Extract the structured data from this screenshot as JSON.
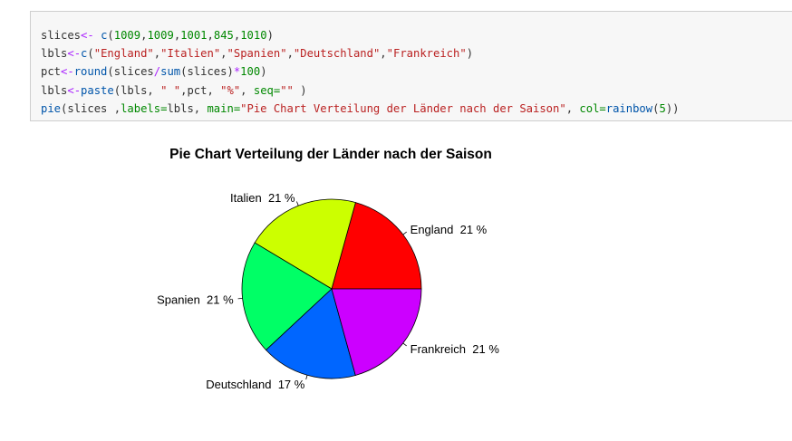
{
  "code_cell": {
    "lines": [
      [
        {
          "t": "slices",
          "c": "v"
        },
        {
          "t": "<-",
          "c": "op"
        },
        {
          "t": " ",
          "c": "p"
        },
        {
          "t": "c",
          "c": "fn"
        },
        {
          "t": "(",
          "c": "p"
        },
        {
          "t": "1009",
          "c": "num"
        },
        {
          "t": ",",
          "c": "p"
        },
        {
          "t": "1009",
          "c": "num"
        },
        {
          "t": ",",
          "c": "p"
        },
        {
          "t": "1001",
          "c": "num"
        },
        {
          "t": ",",
          "c": "p"
        },
        {
          "t": "845",
          "c": "num"
        },
        {
          "t": ",",
          "c": "p"
        },
        {
          "t": "1010",
          "c": "num"
        },
        {
          "t": ")",
          "c": "p"
        }
      ],
      [
        {
          "t": "lbls",
          "c": "v"
        },
        {
          "t": "<-",
          "c": "op"
        },
        {
          "t": "c",
          "c": "fn"
        },
        {
          "t": "(",
          "c": "p"
        },
        {
          "t": "\"England\"",
          "c": "str"
        },
        {
          "t": ",",
          "c": "p"
        },
        {
          "t": "\"Italien\"",
          "c": "str"
        },
        {
          "t": ",",
          "c": "p"
        },
        {
          "t": "\"Spanien\"",
          "c": "str"
        },
        {
          "t": ",",
          "c": "p"
        },
        {
          "t": "\"Deutschland\"",
          "c": "str"
        },
        {
          "t": ",",
          "c": "p"
        },
        {
          "t": "\"Frankreich\"",
          "c": "str"
        },
        {
          "t": ")",
          "c": "p"
        }
      ],
      [
        {
          "t": "pct",
          "c": "v"
        },
        {
          "t": "<-",
          "c": "op"
        },
        {
          "t": "round",
          "c": "fn"
        },
        {
          "t": "(slices",
          "c": "p"
        },
        {
          "t": "/",
          "c": "op"
        },
        {
          "t": "sum",
          "c": "fn"
        },
        {
          "t": "(slices)",
          "c": "p"
        },
        {
          "t": "*",
          "c": "op"
        },
        {
          "t": "100",
          "c": "num"
        },
        {
          "t": ")",
          "c": "p"
        }
      ],
      [
        {
          "t": "lbls",
          "c": "v"
        },
        {
          "t": "<-",
          "c": "op"
        },
        {
          "t": "paste",
          "c": "fn"
        },
        {
          "t": "(lbls, ",
          "c": "p"
        },
        {
          "t": "\" \"",
          "c": "str"
        },
        {
          "t": ",pct, ",
          "c": "p"
        },
        {
          "t": "\"%\"",
          "c": "str"
        },
        {
          "t": ", ",
          "c": "p"
        },
        {
          "t": "seq=",
          "c": "arg"
        },
        {
          "t": "\"\"",
          "c": "str"
        },
        {
          "t": " )",
          "c": "p"
        }
      ],
      [
        {
          "t": "pie",
          "c": "fn"
        },
        {
          "t": "(slices ,",
          "c": "p"
        },
        {
          "t": "labels=",
          "c": "arg"
        },
        {
          "t": "lbls, ",
          "c": "p"
        },
        {
          "t": "main=",
          "c": "arg"
        },
        {
          "t": "\"Pie Chart Verteilung der Länder nach der Saison\"",
          "c": "str"
        },
        {
          "t": ", ",
          "c": "p"
        },
        {
          "t": "col=",
          "c": "arg"
        },
        {
          "t": "rainbow",
          "c": "fn"
        },
        {
          "t": "(",
          "c": "p"
        },
        {
          "t": "5",
          "c": "num"
        },
        {
          "t": "))",
          "c": "p"
        }
      ]
    ]
  },
  "chart_data": {
    "type": "pie",
    "title": "Pie Chart Verteilung der Länder nach der Saison",
    "categories": [
      "England",
      "Italien",
      "Spanien",
      "Deutschland",
      "Frankreich"
    ],
    "values": [
      1009,
      1009,
      1001,
      845,
      1010
    ],
    "labels": [
      "England  21 %",
      "Italien  21 %",
      "Spanien  21 %",
      "Deutschland  17 %",
      "Frankreich  21 %"
    ],
    "colors": [
      "#ff0000",
      "#ccff00",
      "#00ff66",
      "#0066ff",
      "#cc00ff"
    ],
    "start_angle_deg": 0,
    "direction": "counterclockwise"
  }
}
